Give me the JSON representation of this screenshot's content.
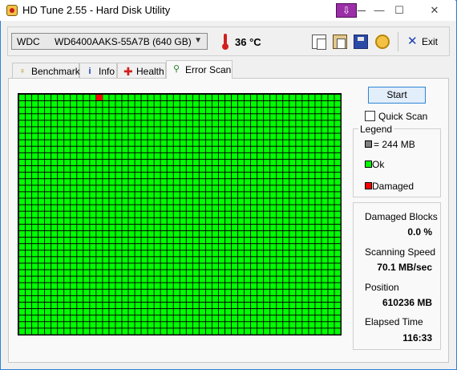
{
  "window": {
    "title": "HD Tune 2.55 - Hard Disk Utility",
    "controls": {
      "minimize": "—",
      "maximize": "☐",
      "close": "✕"
    }
  },
  "toolbar": {
    "drive_vendor": "WDC",
    "drive_model": "WD6400AAKS-55A7B (640 GB)",
    "temperature": "36 °C",
    "icons": [
      "copy-icon",
      "paste-icon",
      "save-icon",
      "options-icon",
      "exit-icon"
    ],
    "exit_label": "Exit"
  },
  "tabs": [
    {
      "label": "Benchmark",
      "icon": "benchmark-icon"
    },
    {
      "label": "Info",
      "icon": "info-icon"
    },
    {
      "label": "Health",
      "icon": "health-icon"
    },
    {
      "label": "Error Scan",
      "icon": "search-icon",
      "active": true
    }
  ],
  "scan": {
    "grid_columns": 50,
    "grid_rows": 37,
    "damaged_blocks": [
      {
        "row": 0,
        "col": 12
      }
    ],
    "colors": {
      "ok": "#00ff00",
      "damaged": "#ff0000",
      "unscanned": "#808080"
    }
  },
  "controls": {
    "start_label": "Start",
    "quick_scan_label": "Quick Scan",
    "quick_scan_checked": false
  },
  "legend": {
    "title": "Legend",
    "block_size": "= 244 MB",
    "ok": "Ok",
    "damaged": "Damaged"
  },
  "stats": {
    "damaged_blocks_label": "Damaged Blocks",
    "damaged_blocks_value": "0.0 %",
    "speed_label": "Scanning Speed",
    "speed_value": "70.1 MB/sec",
    "position_label": "Position",
    "position_value": "610236 MB",
    "elapsed_label": "Elapsed Time",
    "elapsed_value": "116:33"
  }
}
